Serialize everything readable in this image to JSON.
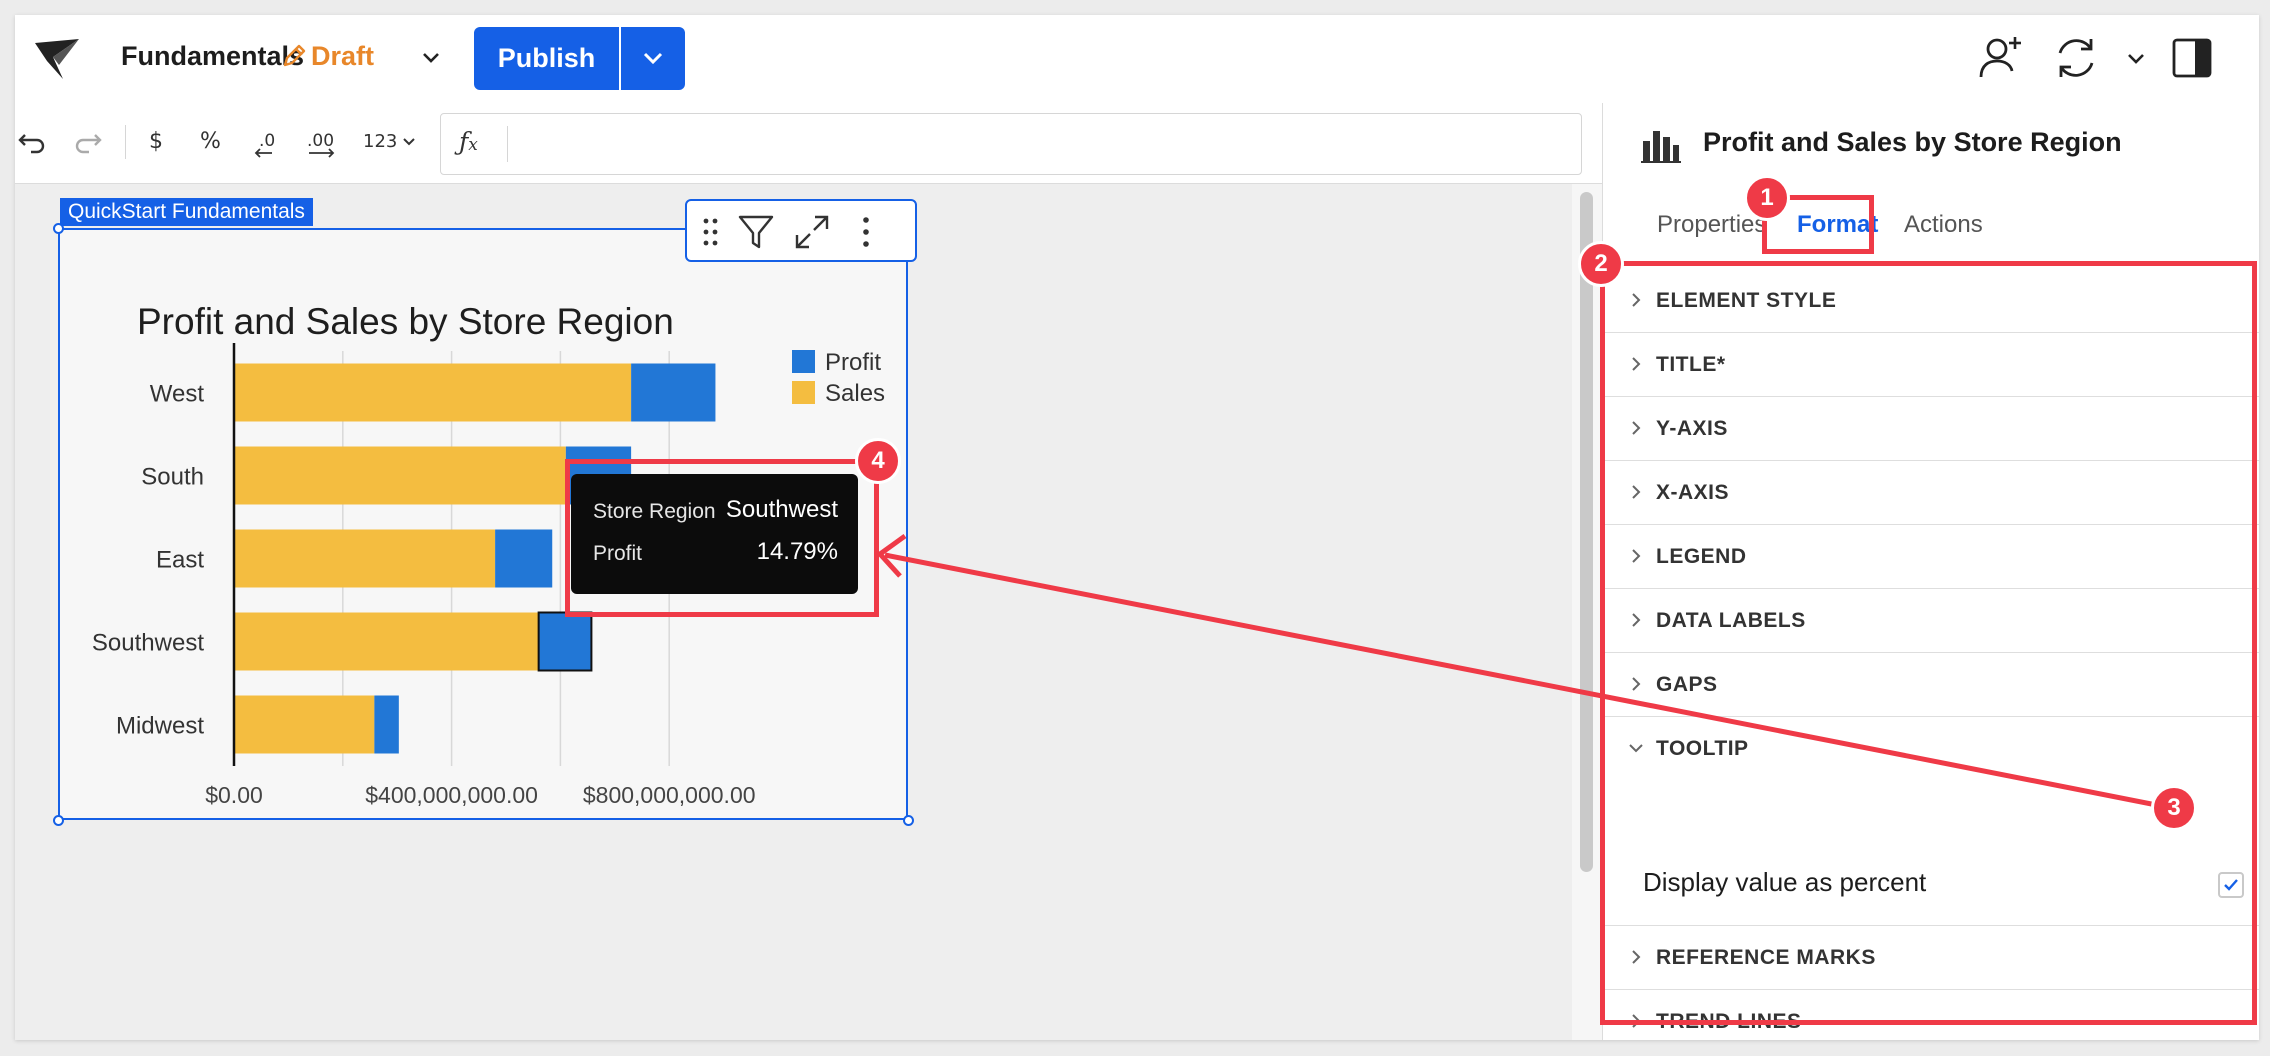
{
  "app": {
    "doc_title": "Fundamentals",
    "draft_label": "Draft",
    "publish_label": "Publish"
  },
  "toolbar": {
    "currency": "$",
    "percent": "%",
    "number_format": "123",
    "formula_label": "fx"
  },
  "canvas": {
    "element_label": "QuickStart Fundamentals"
  },
  "chart_data": {
    "type": "bar",
    "orientation": "horizontal",
    "stacked": true,
    "title": "Profit and Sales by Store Region",
    "categories": [
      "West",
      "South",
      "East",
      "Southwest",
      "Midwest"
    ],
    "series": [
      {
        "name": "Sales",
        "color": "#f4bd40",
        "values": [
          730000000,
          610000000,
          480000000,
          560000000,
          258000000
        ]
      },
      {
        "name": "Profit",
        "color": "#2277d6",
        "values": [
          155000000,
          120000000,
          105000000,
          97000000,
          45000000
        ]
      }
    ],
    "xlim": [
      0,
      1000000000
    ],
    "xticks": [
      0,
      400000000,
      800000000
    ],
    "xtick_labels": [
      "$0.00",
      "$400,000,000.00",
      "$800,000,000.00"
    ],
    "xlabel": "",
    "ylabel": "",
    "legend": [
      "Profit",
      "Sales"
    ],
    "legend_position": "top-right",
    "grid": true
  },
  "tooltip": {
    "key1": "Store Region",
    "value1": "Southwest",
    "key2": "Profit",
    "value2": "14.79%"
  },
  "panel": {
    "title": "Profit and Sales by Store Region",
    "tabs": [
      {
        "label": "Properties",
        "active": false
      },
      {
        "label": "Format",
        "active": true
      },
      {
        "label": "Actions",
        "active": false
      }
    ],
    "sections": [
      {
        "label": "ELEMENT STYLE",
        "expanded": false
      },
      {
        "label": "TITLE*",
        "expanded": false
      },
      {
        "label": "Y-AXIS",
        "expanded": false
      },
      {
        "label": "X-AXIS",
        "expanded": false
      },
      {
        "label": "LEGEND",
        "expanded": false
      },
      {
        "label": "DATA LABELS",
        "expanded": false
      },
      {
        "label": "GAPS",
        "expanded": false
      },
      {
        "label": "TOOLTIP",
        "expanded": true
      },
      {
        "label": "REFERENCE MARKS",
        "expanded": false
      },
      {
        "label": "TREND LINES",
        "expanded": false
      }
    ],
    "tooltip_option": {
      "label": "Display value as percent",
      "checked": true
    }
  },
  "annotations": {
    "badges": [
      "1",
      "2",
      "3",
      "4"
    ],
    "color": "#ef3a47"
  }
}
